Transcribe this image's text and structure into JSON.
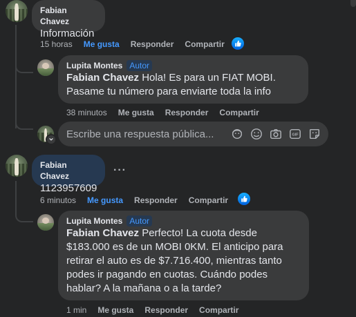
{
  "comments": [
    {
      "author": "Fabian Chavez",
      "text": "Información",
      "time": "15 horas",
      "like": "Me gusta",
      "reply": "Responder",
      "share": "Compartir",
      "liked": true,
      "reaction_icon": "like-icon"
    },
    {
      "author": "Lupita Montes",
      "role": "Autor",
      "mention": "Fabian Chavez",
      "text": " Hola! Es para un FIAT MOBI. Pasame tu número para enviarte toda la info",
      "time": "38 minutos",
      "like": "Me gusta",
      "reply": "Responder",
      "share": "Compartir",
      "liked": false
    },
    {
      "author": "Fabian Chavez",
      "text": "1123957609",
      "time": "6 minutos",
      "like": "Me gusta",
      "reply": "Responder",
      "share": "Compartir",
      "liked": true,
      "more": "···",
      "reaction_icon": "like-icon"
    },
    {
      "author": "Lupita Montes",
      "role": "Autor",
      "mention": "Fabian Chavez",
      "text": " Perfecto! La cuota desde $183.000 es de un MOBI 0KM. El anticipo para retirar el auto es de $7.716.400, mientras tanto podes ir pagando en cuotas. Cuándo podes hablar? A la mañana o a la tarde?",
      "time": "1 min",
      "like": "Me gusta",
      "reply": "Responder",
      "share": "Compartir",
      "liked": false
    }
  ],
  "reply_box": {
    "placeholder": "Escribe una respuesta pública...",
    "icons": [
      "avatar-sticker-icon",
      "emoji-icon",
      "camera-icon",
      "gif-icon",
      "sticker-icon"
    ]
  },
  "colors": {
    "background": "#242526",
    "bubble": "#3a3b3c",
    "bubble_highlight": "#263951",
    "accent": "#4599ff",
    "muted_text": "#b0b3b8"
  }
}
